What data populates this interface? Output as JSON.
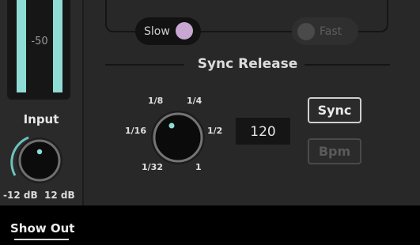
{
  "meter": {
    "scale_label": "-50",
    "level_left": 0.95,
    "level_right": 0.95
  },
  "input": {
    "label": "Input",
    "min_label": "-12 dB",
    "max_label": "12 dB"
  },
  "mode_toggle": {
    "slow_label": "Slow",
    "fast_label": "Fast",
    "selected": "Slow"
  },
  "sync_release": {
    "title": "Sync Release",
    "ticks": [
      "1/8",
      "1/4",
      "1/16",
      "1/2",
      "1/32",
      "1"
    ],
    "value": "120",
    "sync_label": "Sync",
    "bpm_label": "Bpm"
  },
  "footer": {
    "tab_label": "Show Out"
  },
  "colors": {
    "accent": "#8fdcd6",
    "slow_dot": "#c9a7d3",
    "panel": "#282828"
  }
}
